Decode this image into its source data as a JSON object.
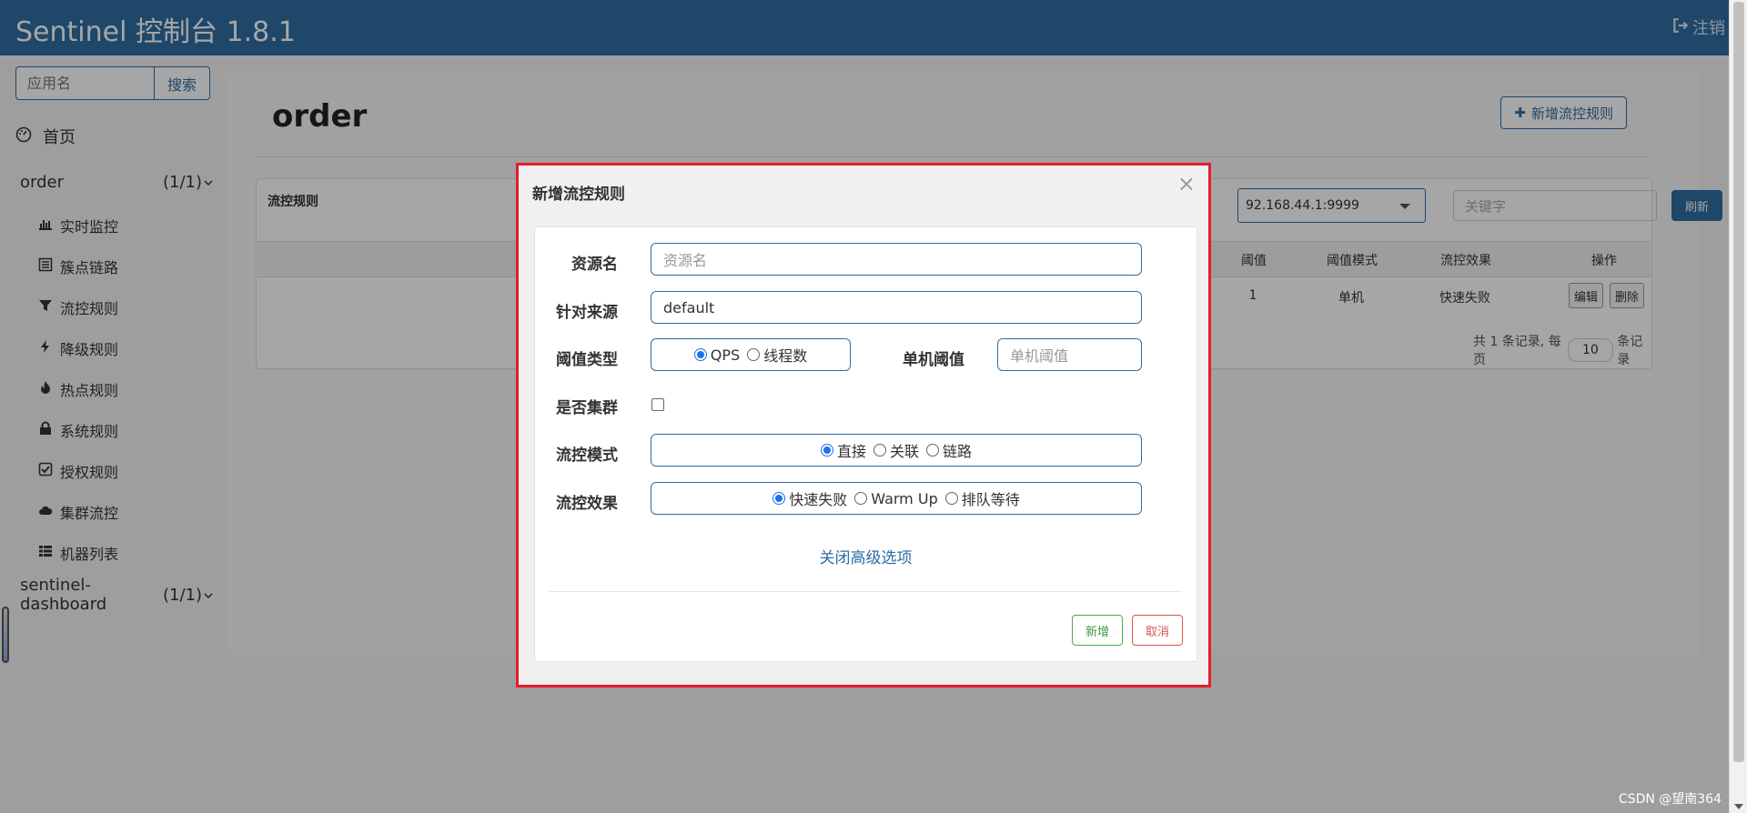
{
  "header": {
    "title": "Sentinel 控制台 1.8.1",
    "logout_label": "注销"
  },
  "sidebar": {
    "search_placeholder": "应用名",
    "search_button": "搜索",
    "home_label": "首页",
    "apps": [
      {
        "name": "order",
        "count": "(1/1)"
      },
      {
        "name": "sentinel-dashboard",
        "count": "(1/1)"
      }
    ],
    "menu": [
      {
        "label": "实时监控",
        "icon": "bar-chart-icon"
      },
      {
        "label": "簇点链路",
        "icon": "list-alt-icon"
      },
      {
        "label": "流控规则",
        "icon": "filter-icon"
      },
      {
        "label": "降级规则",
        "icon": "flash-icon"
      },
      {
        "label": "热点规则",
        "icon": "fire-icon"
      },
      {
        "label": "系统规则",
        "icon": "lock-icon"
      },
      {
        "label": "授权规则",
        "icon": "check-icon"
      },
      {
        "label": "集群流控",
        "icon": "cloud-icon"
      },
      {
        "label": "机器列表",
        "icon": "th-list-icon"
      }
    ]
  },
  "main": {
    "page_title": "order",
    "add_rule_button": "新增流控规则",
    "panel_title": "流控规则",
    "machine_select": "92.168.44.1:9999",
    "keyword_placeholder": "关键字",
    "refresh_button": "刷新",
    "table": {
      "headers": [
        "阈值",
        "阈值模式",
        "流控效果",
        "操作"
      ],
      "row": [
        "1",
        "单机",
        "快速失败"
      ],
      "edit": "编辑",
      "delete": "删除"
    },
    "pager": {
      "prefix": "共 1 条记录, 每页",
      "page_size": "10",
      "suffix": "条记录"
    }
  },
  "modal": {
    "title": "新增流控规则",
    "close": "×",
    "fields": {
      "resource_label": "资源名",
      "resource_placeholder": "资源名",
      "source_label": "针对来源",
      "source_value": "default",
      "grade_label": "阈值类型",
      "grade_options": [
        "QPS",
        "线程数"
      ],
      "threshold_label": "单机阈值",
      "threshold_placeholder": "单机阈值",
      "cluster_label": "是否集群",
      "strategy_label": "流控模式",
      "strategy_options": [
        "直接",
        "关联",
        "链路"
      ],
      "effect_label": "流控效果",
      "effect_options": [
        "快速失败",
        "Warm Up",
        "排队等待"
      ]
    },
    "advanced_link": "关闭高级选项",
    "add_button": "新增",
    "cancel_button": "取消"
  },
  "watermark": "CSDN @望南364",
  "colors": {
    "header": "#2e6da4",
    "modal_highlight": "#e41c2d",
    "add": "#4cae4c",
    "cancel": "#d9534f"
  }
}
